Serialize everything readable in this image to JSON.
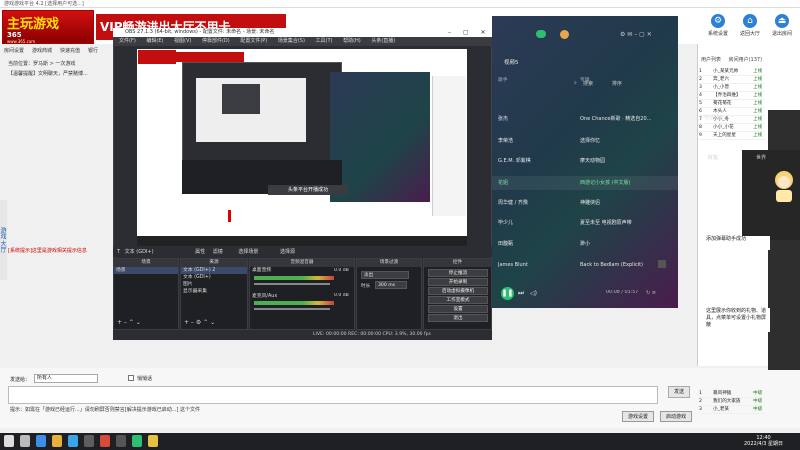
{
  "host": {
    "title_bar": "游戏游戏平台 4.2 [选择用户可选...]",
    "logo_line1": "主玩游戏",
    "logo_line2": "365",
    "logo_line3": "www.365.com",
    "vip_banner": "VIP畅游进出大厅不用卡",
    "toolbar": [
      "房间设置",
      "游戏商城",
      "快速充值",
      "银行",
      "更多"
    ],
    "info1": "当前位置：罗马斯 > 一次游戏",
    "info2": "【温馨提醒】文明聊天，严禁赌博...",
    "left_rail": "游戏 大厅",
    "notice_red": "[系统提示]这里是游戏相关提示信息",
    "send_label": "发送给：",
    "send_target": "所有人",
    "check_label": "悄悄话",
    "send_button": "发送",
    "tip_text": "提示：如需在「游戏已经运行...」请勿刷屏否则禁言[解决提示游戏已启动...] 这个文件",
    "btn_game_settings": "游戏设置",
    "btn_start_game": "启动游戏"
  },
  "right_panel": {
    "icons": [
      {
        "name": "system-settings",
        "label": "系统设置",
        "glyph": "⚙"
      },
      {
        "name": "return-lobby",
        "label": "返回大厅",
        "glyph": "⌂"
      },
      {
        "name": "exit-room",
        "label": "退出房间",
        "glyph": "⏏"
      }
    ],
    "tabs": [
      "用户列表",
      "房间用户(137)"
    ],
    "players": [
      {
        "id": "1",
        "name": "小_某某元帅",
        "state": "上线"
      },
      {
        "id": "2",
        "name": "奔_老六",
        "state": "上线"
      },
      {
        "id": "3",
        "name": "小_小曾",
        "state": "上线"
      },
      {
        "id": "4",
        "name": "【乔治四维】",
        "state": "上线"
      },
      {
        "id": "5",
        "name": "菊花菊花",
        "state": "上线"
      },
      {
        "id": "6",
        "name": "木头人",
        "state": "上线"
      },
      {
        "id": "7",
        "name": "小小_冬",
        "state": "上线"
      },
      {
        "id": "8",
        "name": "小小_小花",
        "state": "上线"
      },
      {
        "id": "9",
        "name": "天上的星星",
        "state": "上线"
      }
    ],
    "chat_head": "传话助手",
    "chat_tabs": [
      "好友",
      "世界"
    ],
    "chat_msg_1": "添加弹幕助手成功",
    "chat_msg_2": "这里展示你收到的礼物、道具，点菜单可设置小礼物屏蔽",
    "players_bottom": [
      {
        "id": "1",
        "name": "暴风神猿",
        "state": "中级"
      },
      {
        "id": "2",
        "name": "我们的大家族",
        "state": "中级"
      },
      {
        "id": "3",
        "name": "小_老某",
        "state": "中级"
      }
    ]
  },
  "obs": {
    "title": "OBS 27.1.3 (64-bit, windows) - 配置文件: 未命名 - 场景: 未命名",
    "menu": [
      "文件(F)",
      "编辑(E)",
      "视图(V)",
      "停靠部件(D)",
      "配置文件(P)",
      "场景集合(S)",
      "工具(T)",
      "帮助(H)",
      "头条(直播)"
    ],
    "toolbar": [
      "文本 (GDI+)",
      "属性",
      "滤镜",
      "选择场景",
      "选择源"
    ],
    "dock_headers": [
      "场景",
      "来源",
      "音频混音器",
      "场景过渡",
      "控件"
    ],
    "scenes": [
      "场景"
    ],
    "sources": [
      "文本 (GDI+) 2",
      "文本 (GDI+)",
      "图片",
      "显示器采集"
    ],
    "mixer": [
      {
        "name": "桌面音频",
        "db": "0.0 dB"
      },
      {
        "name": "麦克风/Aux",
        "db": "0.0 dB"
      }
    ],
    "transition": "淡出",
    "duration_label": "时长",
    "duration_value": "300 ms",
    "controls": [
      "停止推流",
      "开始录制",
      "启动虚拟摄像机",
      "工作室模式",
      "设置",
      "退出"
    ],
    "status": "LIVE: 00:00:00  REC: 00:00:00  CPU: 3.9%, 30.00 fps",
    "toast": "头条平台开播成功"
  },
  "music": {
    "section": "视频5",
    "header_artist": "歌手",
    "header_song": "专辑",
    "rows": [
      {
        "artist": "张杰",
        "song": "One Chance新歌 · 精选自20..."
      },
      {
        "artist": "李荣浩",
        "song": "选择你忆"
      },
      {
        "artist": "G.E.M. 邓紫棋",
        "song": "摩天动物园"
      },
      {
        "artist": "花姐",
        "song": "西游记小女孩 (中文版)",
        "hl": true
      },
      {
        "artist": "周华健 / 齐豫",
        "song": "神雕侠侣"
      },
      {
        "artist": "毕少儿",
        "song": "夏至未至 电视剧原声带"
      },
      {
        "artist": "田馥甄",
        "song": "渺小"
      },
      {
        "artist": "James Blunt",
        "song": "Back to Bedlam (Explicit)"
      }
    ],
    "time": "00:08 / 03:57",
    "search": "搜索",
    "sort": "排序"
  },
  "taskbar": {
    "time": "12:40",
    "date": "2022/4/3 星期日"
  },
  "colors": {
    "accent": "#2fbf72",
    "host_red": "#c20e0e",
    "obs_bg": "#2b2d32"
  }
}
